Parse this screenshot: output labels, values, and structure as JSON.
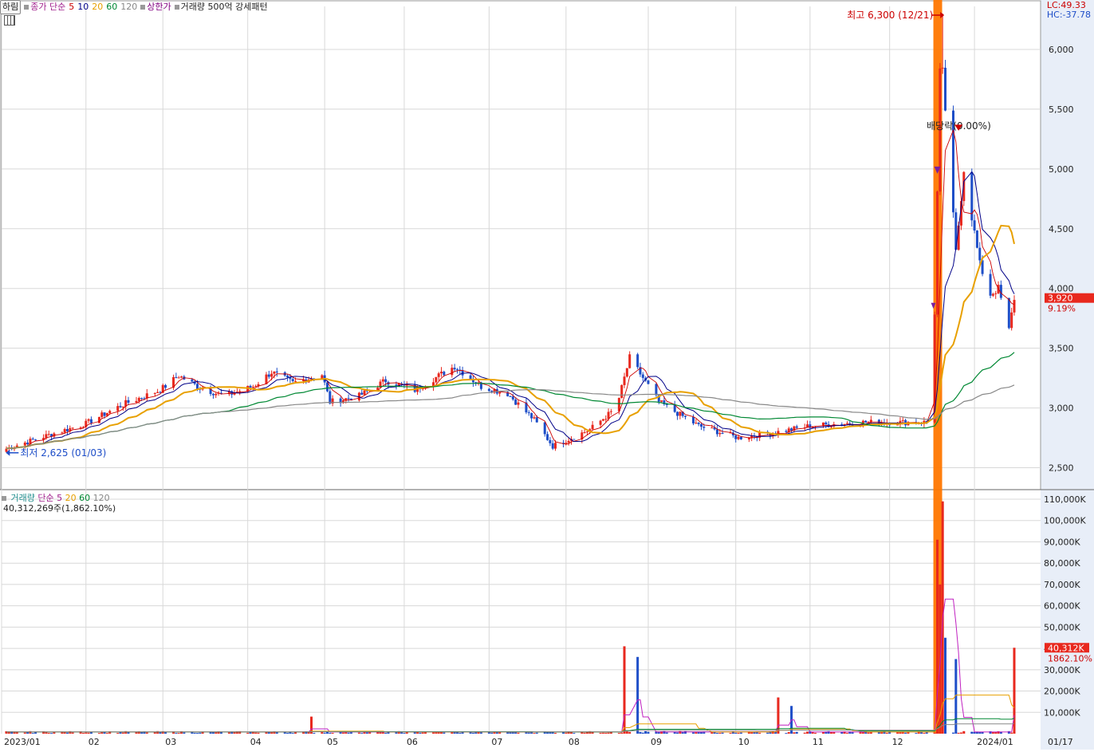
{
  "legend": {
    "chip": "하림",
    "close_ma": "종가 단순",
    "ma_periods": [
      "5",
      "10",
      "20",
      "60",
      "120"
    ],
    "ma_colors": [
      "#cc0000",
      "#000088",
      "#e8a000",
      "#008833",
      "#888888"
    ],
    "upper_limit": "상한가",
    "volume_pattern": "거래량 500억 강세패턴"
  },
  "indicators": {
    "lc": "LC:49.33",
    "hc": "HC:-37.78"
  },
  "price_annotations": {
    "high_label": "최고 6,300 (12/21)",
    "low_label": "최저 2,625 (01/03)",
    "dividend_label": "배당락(0.00%)",
    "current_price": "3,920",
    "current_change": "9.19%"
  },
  "volume_panel": {
    "legend_name": "거래량",
    "legend_ma": "단순",
    "ma_periods": [
      "5",
      "20",
      "60",
      "120"
    ],
    "value_text": "40,312,269주(1,862.10%)",
    "current_volume": "40,312K",
    "current_pct": "1862.10%"
  },
  "colors": {
    "up": "#e8281e",
    "down": "#1e4ec8",
    "highlight": "#ff7700",
    "axis_bg": "#e8eef8"
  },
  "chart_data": [
    {
      "type": "candlestick",
      "title": "하림",
      "x_ticks": [
        "2023/01",
        "02",
        "03",
        "04",
        "05",
        "06",
        "07",
        "08",
        "09",
        "10",
        "11",
        "12",
        "2024/01",
        "01/17"
      ],
      "y_ticks": [
        2500,
        3000,
        3500,
        4000,
        4500,
        5000,
        5500,
        6000
      ],
      "y_tick_labels": [
        "2,500",
        "3,000",
        "3,500",
        "4,000",
        "4,500",
        "5,000",
        "5,500",
        "6,000"
      ],
      "ylim": [
        2330,
        6360
      ],
      "close_path": [
        [
          "2023-01-02",
          2660
        ],
        [
          "2023-01-16",
          2760
        ],
        [
          "2023-02-01",
          2870
        ],
        [
          "2023-02-15",
          3030
        ],
        [
          "2023-03-01",
          3150
        ],
        [
          "2023-03-08",
          3270
        ],
        [
          "2023-03-15",
          3180
        ],
        [
          "2023-03-25",
          3100
        ],
        [
          "2023-04-05",
          3180
        ],
        [
          "2023-04-12",
          3300
        ],
        [
          "2023-04-20",
          3210
        ],
        [
          "2023-05-01",
          3280
        ],
        [
          "2023-05-04",
          3050
        ],
        [
          "2023-05-15",
          3100
        ],
        [
          "2023-05-25",
          3230
        ],
        [
          "2023-06-05",
          3150
        ],
        [
          "2023-06-20",
          3350
        ],
        [
          "2023-06-30",
          3180
        ],
        [
          "2023-07-10",
          3120
        ],
        [
          "2023-07-20",
          2900
        ],
        [
          "2023-07-27",
          2680
        ],
        [
          "2023-08-10",
          2820
        ],
        [
          "2023-08-20",
          3000
        ],
        [
          "2023-08-25",
          3420
        ],
        [
          "2023-09-05",
          3050
        ],
        [
          "2023-09-20",
          2850
        ],
        [
          "2023-10-05",
          2750
        ],
        [
          "2023-10-20",
          2800
        ],
        [
          "2023-11-01",
          2850
        ],
        [
          "2023-11-20",
          2880
        ],
        [
          "2023-12-15",
          2880
        ],
        [
          "2023-12-18",
          3800
        ],
        [
          "2023-12-20",
          5800
        ],
        [
          "2023-12-21",
          5800
        ],
        [
          "2023-12-26",
          4300
        ],
        [
          "2023-12-29",
          5000
        ],
        [
          "2024-01-04",
          4200
        ],
        [
          "2024-01-08",
          3950
        ],
        [
          "2024-01-11",
          4000
        ],
        [
          "2024-01-15",
          3650
        ],
        [
          "2024-01-17",
          3920
        ]
      ],
      "high": {
        "date": "2023-12-21",
        "value": 6300,
        "label": "최고 6,300 (12/21)"
      },
      "low": {
        "date": "2023-01-03",
        "value": 2625,
        "label": "최저 2,625 (01/03)"
      },
      "ma_series": [
        {
          "name": "5",
          "color": "#cc0000"
        },
        {
          "name": "10",
          "color": "#000088"
        },
        {
          "name": "20",
          "color": "#e8a000"
        },
        {
          "name": "60",
          "color": "#008833"
        },
        {
          "name": "120",
          "color": "#888888"
        }
      ],
      "last_close": 3920,
      "last_change_pct": 9.19
    },
    {
      "type": "bar",
      "title": "거래량",
      "y_ticks": [
        10000,
        20000,
        30000,
        40000,
        50000,
        60000,
        70000,
        80000,
        90000,
        100000,
        110000
      ],
      "y_tick_labels": [
        "10,000K",
        "20,000K",
        "30,000K",
        "40,000K",
        "50,000K",
        "60,000K",
        "70,000K",
        "80,000K",
        "90,000K",
        "100,000K",
        "110,000K"
      ],
      "ylim": [
        0,
        113000
      ],
      "unit": "K",
      "spikes": [
        {
          "date": "2023-04-27",
          "value": 8000
        },
        {
          "date": "2023-08-23",
          "value": 41000
        },
        {
          "date": "2023-08-28",
          "value": 36000
        },
        {
          "date": "2023-10-20",
          "value": 17000
        },
        {
          "date": "2023-10-25",
          "value": 13000
        },
        {
          "date": "2023-12-19",
          "value": 91000
        },
        {
          "date": "2023-12-20",
          "value": 70000
        },
        {
          "date": "2023-12-21",
          "value": 109000
        },
        {
          "date": "2023-12-22",
          "value": 45000
        },
        {
          "date": "2023-12-26",
          "value": 35000
        },
        {
          "date": "2024-01-17",
          "value": 40312
        }
      ],
      "last_value": 40312
    }
  ]
}
